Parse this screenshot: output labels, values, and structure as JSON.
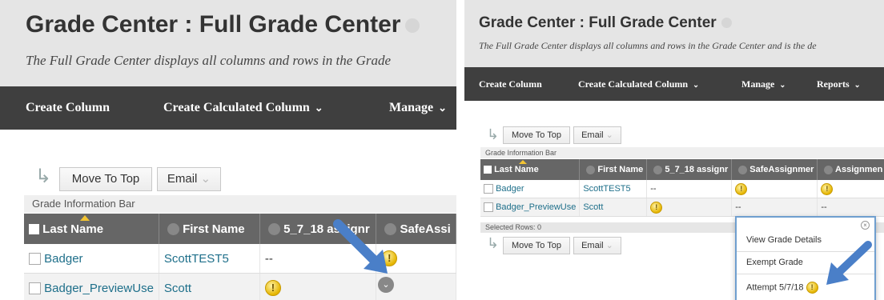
{
  "left": {
    "title": "Grade Center : Full Grade Center",
    "description": "The Full Grade Center displays all columns and rows in the Grade",
    "nav": [
      {
        "label": "Create Column",
        "has_caret": false
      },
      {
        "label": "Create Calculated Column",
        "has_caret": true
      },
      {
        "label": "Manage",
        "has_caret": true
      }
    ],
    "toolbar": {
      "move_to_top": "Move To Top",
      "email": "Email"
    },
    "info_bar": "Grade Information Bar",
    "columns": [
      "Last Name",
      "First Name",
      "5_7_18 assignr",
      "SafeAssi"
    ],
    "rows": [
      {
        "last": "Badger",
        "first": "ScottTEST5",
        "c1": "--",
        "c2": "!"
      },
      {
        "last": "Badger_PreviewUse",
        "first": "Scott",
        "c1": "!",
        "c2": "--"
      }
    ]
  },
  "right": {
    "title": "Grade Center : Full Grade Center",
    "description": "The Full Grade Center displays all columns and rows in the Grade Center and is the de",
    "nav": [
      {
        "label": "Create Column",
        "has_caret": false
      },
      {
        "label": "Create Calculated Column",
        "has_caret": true
      },
      {
        "label": "Manage",
        "has_caret": true
      },
      {
        "label": "Reports",
        "has_caret": true
      }
    ],
    "toolbar": {
      "move_to_top": "Move To Top",
      "email": "Email"
    },
    "info_bar": "Grade Information Bar",
    "columns": [
      "Last Name",
      "First Name",
      "5_7_18 assignr",
      "SafeAssignmer",
      "Assignmen"
    ],
    "rows": [
      {
        "last": "Badger",
        "first": "ScottTEST5",
        "c1": "--",
        "c2": "!",
        "c3": "!"
      },
      {
        "last": "Badger_PreviewUse",
        "first": "Scott",
        "c1": "!",
        "c2": "--",
        "c3": "--"
      }
    ],
    "selected_rows": "Selected Rows: 0",
    "context_menu": {
      "items": [
        "View Grade Details",
        "Exempt Grade",
        "Attempt 5/7/18"
      ]
    }
  },
  "colors": {
    "header_bg": "#e5e5e5",
    "navbar_bg": "#3f3f3f",
    "grid_header_bg": "#666666",
    "link": "#1e6f8a",
    "annotation_arrow": "#4a7fc8",
    "warning": "#e5b500"
  },
  "icons": {
    "needs_grading": "exclamation-circle-icon",
    "row_indent": "indent-arrow-icon",
    "annotation": "blue-pointer-arrow-icon"
  }
}
